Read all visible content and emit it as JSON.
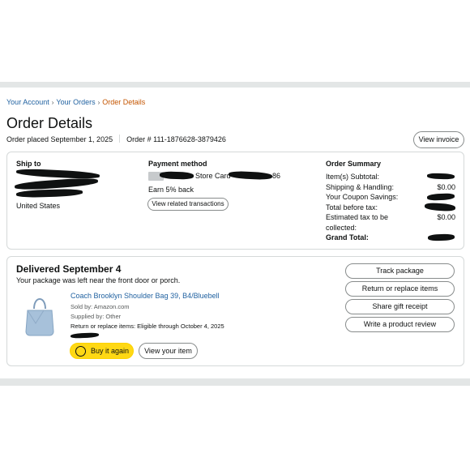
{
  "breadcrumb": {
    "items": [
      "Your Account",
      "Your Orders"
    ],
    "current": "Order Details"
  },
  "page": {
    "title": "Order Details",
    "order_placed": "Order placed September 1, 2025",
    "order_number": "Order # 111-1876628-3879426",
    "view_invoice": "View invoice"
  },
  "ship_to": {
    "label": "Ship to",
    "country": "United States"
  },
  "payment": {
    "label": "Payment method",
    "card": "Store Card",
    "card_suffix": "86",
    "earn": "Earn 5% back",
    "related_button": "View related transactions"
  },
  "summary": {
    "label": "Order Summary",
    "rows": [
      {
        "label": "Item(s) Subtotal:",
        "value": ""
      },
      {
        "label": "Shipping & Handling:",
        "value": "$0.00"
      },
      {
        "label": "Your Coupon Savings:",
        "value": ""
      },
      {
        "label": "Total before tax:",
        "value": ""
      },
      {
        "label": "Estimated tax to be",
        "value": "$0.00"
      },
      {
        "label": "collected:",
        "value": ""
      }
    ],
    "grand_total_label": "Grand Total:"
  },
  "delivery": {
    "title": "Delivered September 4",
    "subtitle": "Your package was left near the front door or porch.",
    "product_name": "Coach Brooklyn Shoulder Bag 39, B4/Bluebell",
    "sold_by": "Sold by: Amazon.com",
    "supplied_by": "Supplied by: Other",
    "return_eligibility": "Return or replace items: Eligible through October 4, 2025",
    "buy_again": "Buy it again",
    "view_item": "View your item"
  },
  "actions": {
    "track": "Track package",
    "return": "Return or replace items",
    "gift": "Share gift receipt",
    "review": "Write a product review"
  },
  "colors": {
    "link": "#2162a1",
    "breadcrumb_current": "#c45500",
    "buy_button": "#ffd814",
    "border": "#d5d9d9",
    "band": "#e3e6e6"
  }
}
